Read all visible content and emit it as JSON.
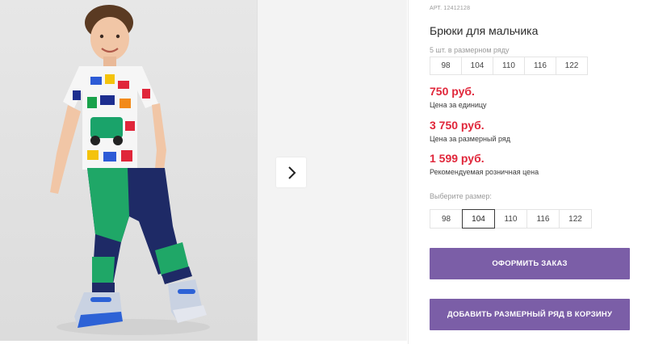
{
  "product": {
    "sku": "АРТ. 12412128",
    "title": "Брюки для мальчика"
  },
  "gallery": {
    "image_alt": "boy-model-photo",
    "next_icon": "chevron-right-icon"
  },
  "size_row": {
    "label": "5 шт. в размерном ряду",
    "sizes": [
      "98",
      "104",
      "110",
      "116",
      "122"
    ]
  },
  "prices": [
    {
      "value": "750 руб.",
      "caption": "Цена за единицу"
    },
    {
      "value": "3 750 руб.",
      "caption": "Цена за размерный ряд"
    },
    {
      "value": "1 599 руб.",
      "caption": "Рекомендуемая розничная цена"
    }
  ],
  "size_select": {
    "label": "Выберите размер:",
    "sizes": [
      "98",
      "104",
      "110",
      "116",
      "122"
    ],
    "selected": "104"
  },
  "buttons": {
    "order": "ОФОРМИТЬ ЗАКАЗ",
    "add_to_cart": "ДОБАВИТЬ РАЗМЕРНЫЙ РЯД В КОРЗИНУ"
  },
  "colors": {
    "price_red": "#e0263a",
    "button_purple": "#7b5ea7"
  }
}
